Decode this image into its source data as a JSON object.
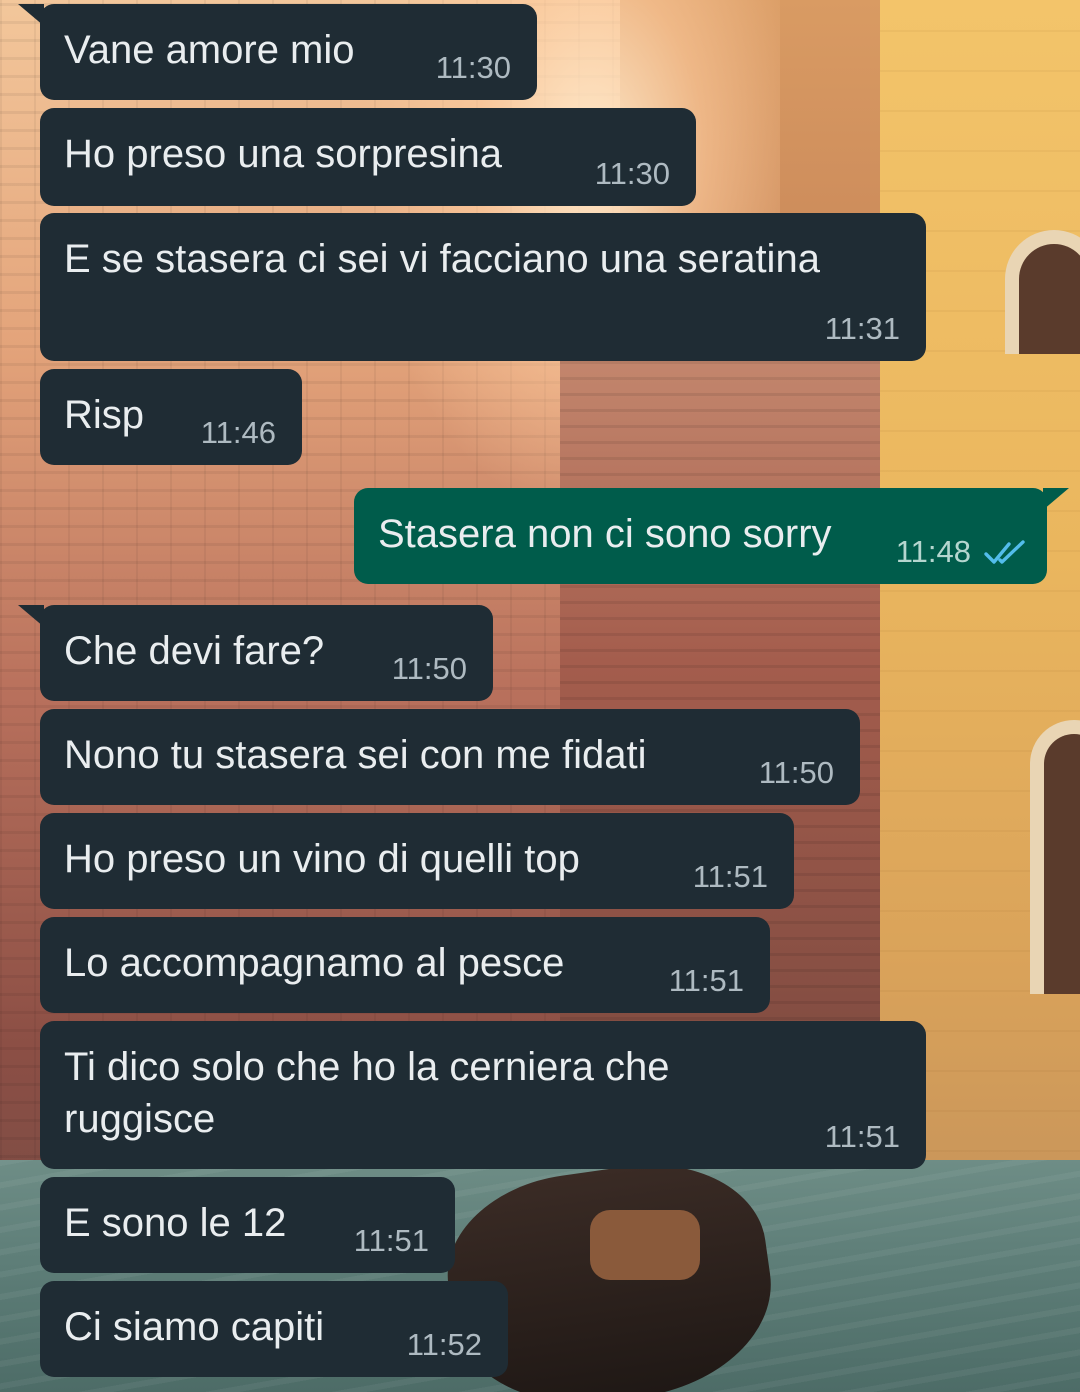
{
  "messages": [
    {
      "direction": "in",
      "text": "Vane amore mio",
      "time": "11:30"
    },
    {
      "direction": "in",
      "text": "Ho preso una sorpresina",
      "time": "11:30"
    },
    {
      "direction": "in",
      "text": "E se stasera ci sei vi facciano una seratina",
      "time": "11:31"
    },
    {
      "direction": "in",
      "text": "Risp",
      "time": "11:46"
    },
    {
      "direction": "out",
      "text": "Stasera non ci sono sorry",
      "time": "11:48",
      "status": "read"
    },
    {
      "direction": "in",
      "text": "Che devi fare?",
      "time": "11:50"
    },
    {
      "direction": "in",
      "text": "Nono tu stasera sei con me fidati",
      "time": "11:50"
    },
    {
      "direction": "in",
      "text": "Ho preso un vino di quelli top",
      "time": "11:51"
    },
    {
      "direction": "in",
      "text": "Lo accompagnamo al pesce",
      "time": "11:51"
    },
    {
      "direction": "in",
      "text": "Ti dico solo che ho la cerniera che ruggisce",
      "time": "11:51"
    },
    {
      "direction": "in",
      "text": "E sono le 12",
      "time": "11:51"
    },
    {
      "direction": "in",
      "text": "Ci siamo capiti",
      "time": "11:52"
    }
  ],
  "colors": {
    "incoming_bubble": "#1f2c34",
    "outgoing_bubble": "#005c4b",
    "message_text": "#e9edef",
    "timestamp": "#aebac1",
    "read_ticks": "#53bdeb"
  },
  "icons": {
    "read_status": "double-check-icon"
  }
}
